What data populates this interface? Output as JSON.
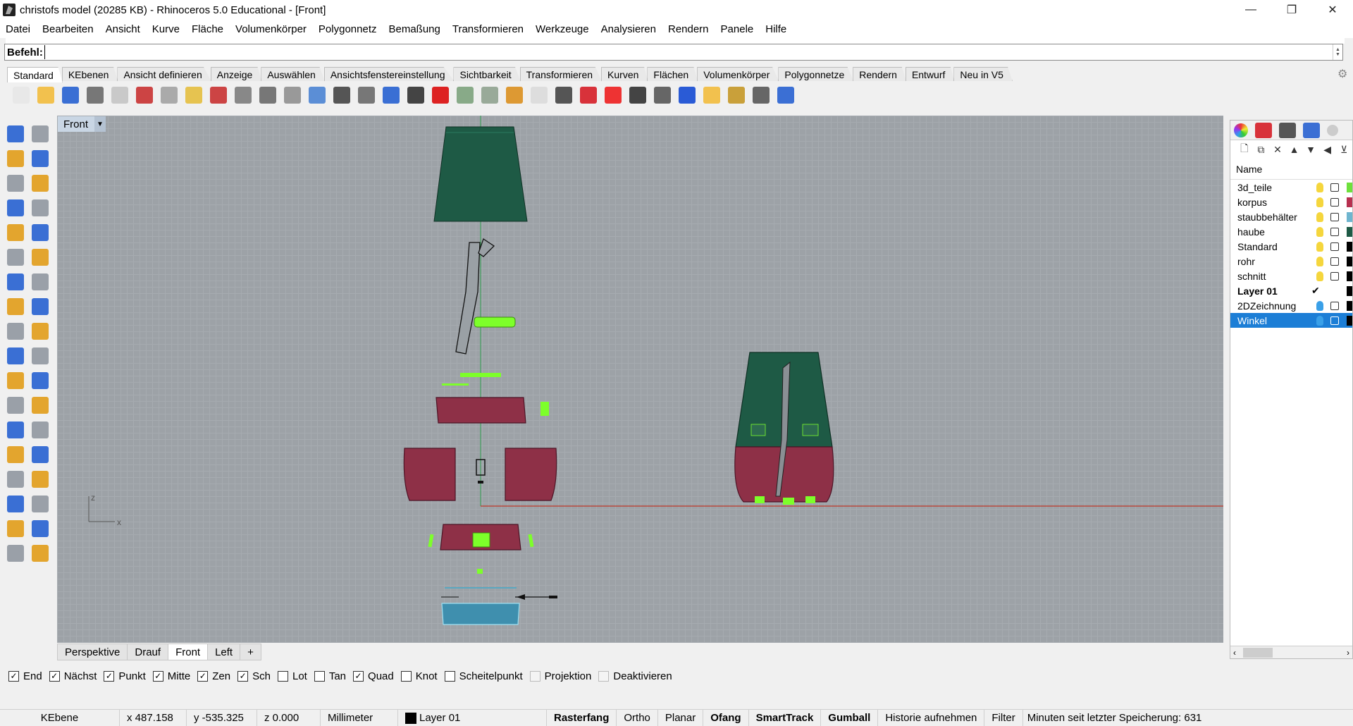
{
  "window": {
    "title": "christofs model (20285 KB) - Rhinoceros 5.0 Educational - [Front]",
    "minimize": "—",
    "restore": "❐",
    "close": "✕"
  },
  "menu": [
    "Datei",
    "Bearbeiten",
    "Ansicht",
    "Kurve",
    "Fläche",
    "Volumenkörper",
    "Polygonnetz",
    "Bemaßung",
    "Transformieren",
    "Werkzeuge",
    "Analysieren",
    "Rendern",
    "Panele",
    "Hilfe"
  ],
  "command": {
    "label": "Befehl:",
    "value": ""
  },
  "toolbar_tabs": [
    "Standard",
    "KEbenen",
    "Ansicht definieren",
    "Anzeige",
    "Auswählen",
    "Ansichtsfenstereinstellung",
    "Sichtbarkeit",
    "Transformieren",
    "Kurven",
    "Flächen",
    "Volumenkörper",
    "Polygonnetze",
    "Rendern",
    "Entwurf",
    "Neu in V5"
  ],
  "toolbar_icons": [
    "new-icon",
    "open-icon",
    "save-icon",
    "print-icon",
    "import-icon",
    "cut-icon",
    "copy-icon",
    "paste-icon",
    "undo-icon",
    "pan-icon",
    "rotate-view-icon",
    "zoom-icon",
    "zoom-window-icon",
    "zoom-extents-icon",
    "zoom-selected-icon",
    "undo-view-icon",
    "viewport-layout-icon",
    "car-icon",
    "object-properties-icon",
    "osnap-icon",
    "snap-icon",
    "light-icon",
    "lock-icon",
    "layer-icon",
    "color-icon",
    "shade-icon",
    "render-preview-icon",
    "material-icon",
    "filter-icon",
    "options-icon",
    "cplane-icon",
    "help-icon"
  ],
  "viewport": {
    "name": "Front",
    "axis_z": "z",
    "axis_x": "x"
  },
  "viewport_tabs": [
    "Perspektive",
    "Drauf",
    "Front",
    "Left"
  ],
  "viewport_tab_add": "+",
  "osnaps": [
    {
      "label": "End",
      "checked": true
    },
    {
      "label": "Nächst",
      "checked": true
    },
    {
      "label": "Punkt",
      "checked": true
    },
    {
      "label": "Mitte",
      "checked": true
    },
    {
      "label": "Zen",
      "checked": true
    },
    {
      "label": "Sch",
      "checked": true
    },
    {
      "label": "Lot",
      "checked": false
    },
    {
      "label": "Tan",
      "checked": false
    },
    {
      "label": "Quad",
      "checked": true
    },
    {
      "label": "Knot",
      "checked": false
    },
    {
      "label": "Scheitelpunkt",
      "checked": false
    },
    {
      "label": "Projektion",
      "checked": false,
      "disabled": true
    },
    {
      "label": "Deaktivieren",
      "checked": false,
      "disabled": true
    }
  ],
  "status": {
    "plane": "KEbene",
    "x": "x 487.158",
    "y": "y -535.325",
    "z": "z 0.000",
    "units": "Millimeter",
    "layer": "Layer 01",
    "toggles": [
      {
        "label": "Rasterfang",
        "bold": true
      },
      {
        "label": "Ortho",
        "bold": false
      },
      {
        "label": "Planar",
        "bold": false
      },
      {
        "label": "Ofang",
        "bold": true
      },
      {
        "label": "SmartTrack",
        "bold": true
      },
      {
        "label": "Gumball",
        "bold": true
      },
      {
        "label": "Historie aufnehmen",
        "bold": false
      },
      {
        "label": "Filter",
        "bold": false
      }
    ],
    "save_info": "Minuten seit letzter Speicherung: 631"
  },
  "layers_panel": {
    "header": "Name",
    "layers": [
      {
        "name": "3d_teile",
        "color": "#6ee03c",
        "current": false,
        "selected": false,
        "bold": false
      },
      {
        "name": "korpus",
        "color": "#b7304f",
        "current": false,
        "selected": false,
        "bold": false
      },
      {
        "name": "staubbehälter",
        "color": "#6fb5cf",
        "current": false,
        "selected": false,
        "bold": false
      },
      {
        "name": "haube",
        "color": "#1e5a45",
        "current": false,
        "selected": false,
        "bold": false
      },
      {
        "name": "Standard",
        "color": "#000000",
        "current": false,
        "selected": false,
        "bold": false
      },
      {
        "name": "rohr",
        "color": "#000000",
        "current": false,
        "selected": false,
        "bold": false
      },
      {
        "name": "schnitt",
        "color": "#000000",
        "current": false,
        "selected": false,
        "bold": false
      },
      {
        "name": "Layer 01",
        "color": "#000000",
        "current": true,
        "selected": false,
        "bold": true
      },
      {
        "name": "2DZeichnung",
        "color": "#000000",
        "current": false,
        "selected": false,
        "bold": false
      },
      {
        "name": "Winkel",
        "color": "#000000",
        "current": false,
        "selected": true,
        "bold": false
      }
    ],
    "current_mark": "✔"
  },
  "colors": {
    "viewport_bg": "#9da2a7",
    "haube": "#1e5a45",
    "korpus": "#8e3047",
    "highlight": "#7dff2a",
    "staub": "#5aa7c0",
    "x_axis": "#c0392b",
    "y_axis": "#2e9e4f",
    "selection": "#1c7ed6"
  }
}
